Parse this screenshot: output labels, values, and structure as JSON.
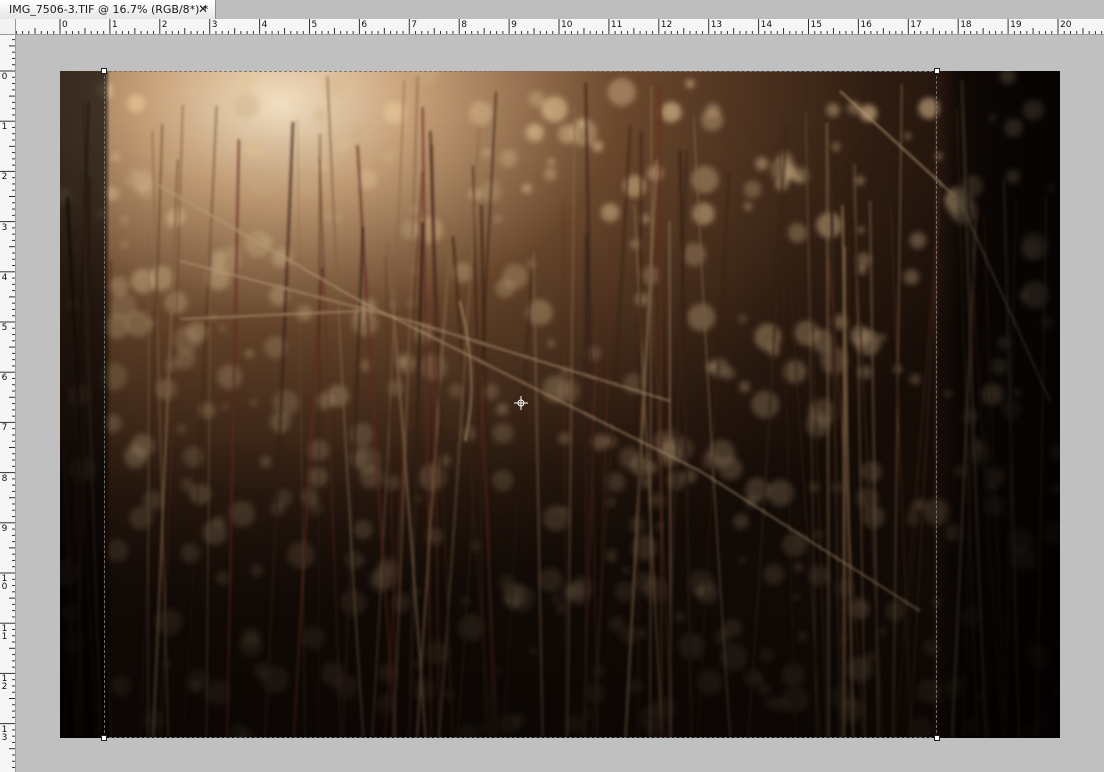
{
  "document_tab": {
    "title": "IMG_7506-3.TIF @ 16.7% (RGB/8*) *",
    "close_glyph": "✕",
    "close_icon": "close-icon"
  },
  "rulers": {
    "horizontal_numbers": [
      "0",
      "1",
      "2",
      "3",
      "4",
      "5",
      "6",
      "7",
      "8",
      "9",
      "10",
      "11",
      "12",
      "13",
      "14",
      "15",
      "16",
      "17",
      "18",
      "19",
      "20"
    ],
    "vertical_numbers": [
      "0",
      "1",
      "2",
      "3",
      "4",
      "5",
      "6",
      "7",
      "8",
      "9",
      "10",
      "11",
      "12",
      "13"
    ]
  },
  "canvas": {
    "background": "#c0c0c0",
    "image_description_icon": "photo-dry-grass-bokeh",
    "selection_style": "crop-marquee",
    "cursor_icon": "crosshair-icon"
  }
}
